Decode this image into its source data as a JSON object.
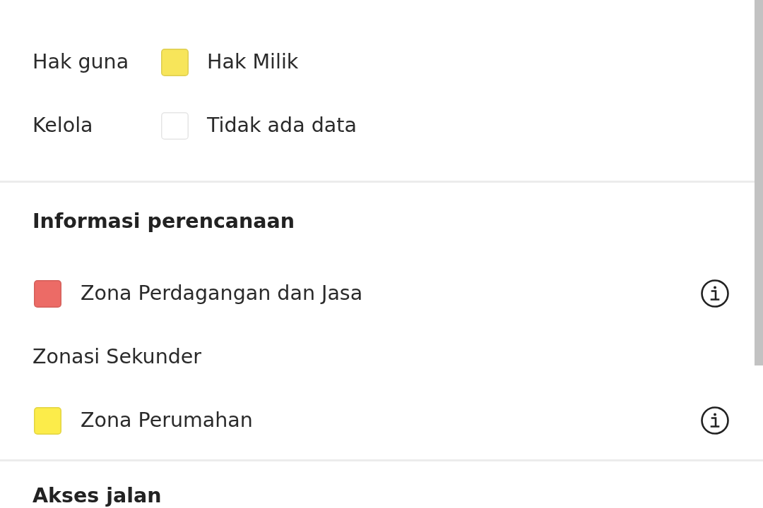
{
  "land_rights": {
    "rows": [
      {
        "label": "Hak guna",
        "legend": {
          "color": "#f7e55a",
          "text": "Hak Milik"
        }
      },
      {
        "label": "Kelola",
        "legend": {
          "color": "#ffffff",
          "text": "Tidak ada data"
        }
      }
    ]
  },
  "planning_info": {
    "title": "Informasi perencanaan",
    "items": [
      {
        "kind": "zone",
        "color": "#ec6b66",
        "text": "Zona Perdagangan dan Jasa"
      },
      {
        "kind": "subheading",
        "text": "Zonasi Sekunder"
      },
      {
        "kind": "zone",
        "color": "#fcec4a",
        "text": "Zona Perumahan"
      }
    ]
  },
  "road_access": {
    "title": "Akses jalan"
  }
}
